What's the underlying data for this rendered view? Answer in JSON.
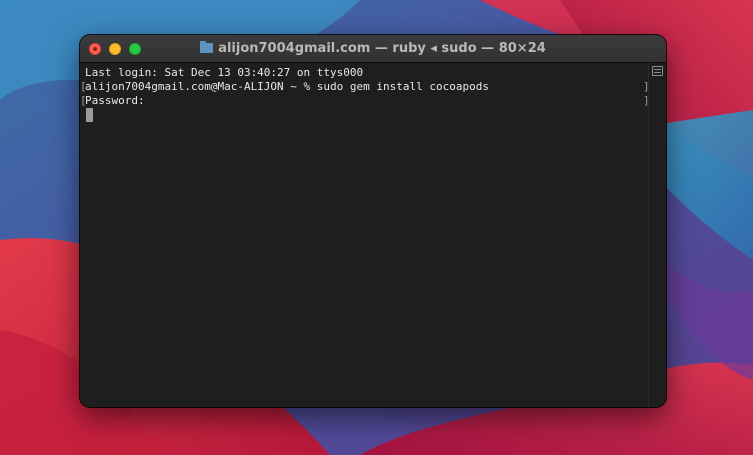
{
  "window": {
    "title": "alijon7004gmail.com — ruby ◂ sudo — 80×24",
    "title_icon": "folder-icon",
    "colors": {
      "background": "#1e1e1e",
      "text": "#e8e8e8",
      "close": "#ff5f57",
      "minimize": "#febc2e",
      "zoom": "#28c840"
    }
  },
  "terminal": {
    "lines": [
      "Last login: Sat Dec 13 03:40:27 on ttys000",
      "alijon7004gmail.com@Mac-ALIJON ~ % sudo gem install cocoapods",
      "Password:"
    ],
    "mark_left": "[",
    "mark_right": "]"
  }
}
